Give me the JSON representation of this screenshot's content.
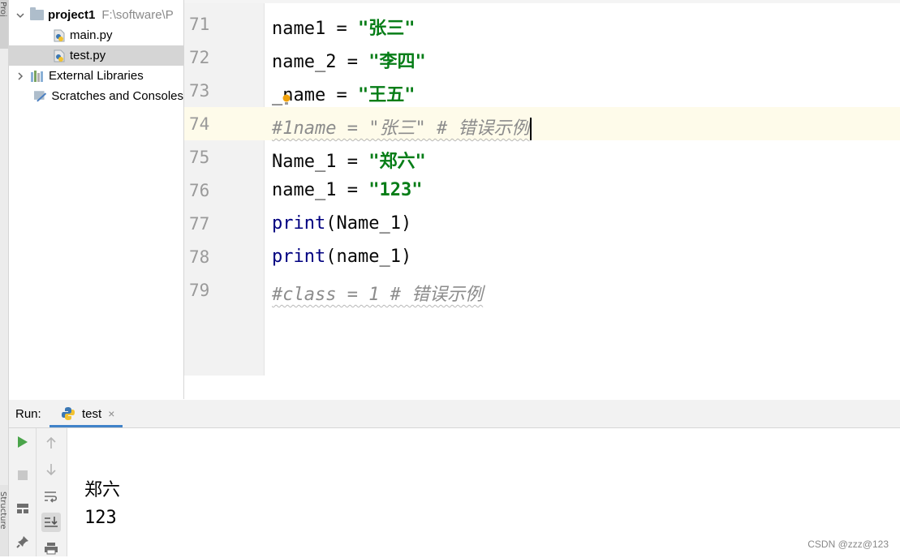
{
  "side_strip": {
    "project_tab": "Proj",
    "structure_tab": "Structure"
  },
  "project_tree": {
    "root": {
      "name": "project1",
      "path": "F:\\software\\P"
    },
    "files": [
      {
        "name": "main.py"
      },
      {
        "name": "test.py",
        "selected": true
      }
    ],
    "external_libraries": "External Libraries",
    "scratches": "Scratches and Consoles"
  },
  "editor": {
    "current_line": "74",
    "lines": [
      {
        "num": "71",
        "a": "name1 = ",
        "b": "\"张三\""
      },
      {
        "num": "72",
        "a": "name_2 = ",
        "b": "\"李四\""
      },
      {
        "num": "73",
        "a": "_name = ",
        "b": "\"王五\""
      },
      {
        "num": "74",
        "comment": "#1name = \"张三\" # 错误示例"
      },
      {
        "num": "75",
        "a": "Name_1 = ",
        "b": "\"郑六\""
      },
      {
        "num": "76",
        "a": "name_1 = ",
        "b": "\"123\""
      },
      {
        "num": "77",
        "kw": "print",
        "rest": "(Name_1)"
      },
      {
        "num": "78",
        "kw": "print",
        "rest": "(name_1)"
      },
      {
        "num": "79",
        "comment": "#class = 1 # 错误示例"
      }
    ]
  },
  "run_panel": {
    "label": "Run:",
    "tab_label": "test",
    "tab_close": "×",
    "output": [
      "郑六",
      "123"
    ]
  },
  "watermark": "CSDN @zzz@123",
  "colors": {
    "string": "#067d17",
    "keyword": "#000080",
    "comment": "#8c8c8c",
    "current_line_bg": "#fefbea",
    "selected_row_bg": "#d5d5d5",
    "run_green": "#4aa44a",
    "tab_underline": "#4083c9"
  }
}
